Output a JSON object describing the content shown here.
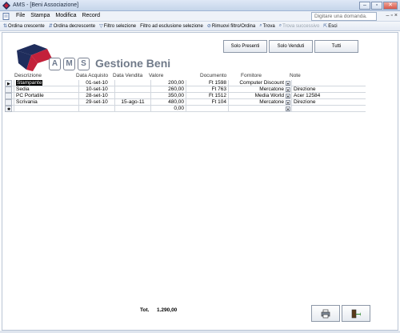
{
  "window": {
    "title": "AMS - [Beni Associazione]",
    "buttons": [
      "–",
      "▫",
      "✕"
    ]
  },
  "menu": {
    "items": [
      "File",
      "Stampa",
      "Modifica",
      "Record"
    ],
    "help_placeholder": "Digitare una domanda.",
    "mdi_buttons": [
      "–",
      "▫",
      "×"
    ]
  },
  "toolbar": {
    "sort_asc": "Ordina crescente",
    "sort_desc": "Ordina decrescente",
    "filter_sel": "Filtro selezione",
    "filter_excl": "Filtro ad esclusione selezione",
    "remove_filter": "Rimuovi filtro/Ordina",
    "find": "Trova",
    "find_next": "Trova successivo",
    "exit": "Esci"
  },
  "logo": {
    "letters": [
      "A",
      "M",
      "S"
    ],
    "title": "Gestione Beni",
    "colors": {
      "navy": "#1f2d5c",
      "red": "#c3213a",
      "gray": "#707a89"
    }
  },
  "filters": {
    "present": "Solo Presenti",
    "sold": "Solo Venduti",
    "all": "Tutti"
  },
  "columns": {
    "desc": "Descrizione",
    "acq": "Data Acquisto",
    "vend": "Data Vendita",
    "val": "Valore",
    "doc": "Documento",
    "forn": "Fornitore",
    "note": "Note"
  },
  "rows": [
    {
      "selector": "▶",
      "desc": "Stampante",
      "acq": "01-set-10",
      "vend": "",
      "val": "200,00",
      "doc": "Ft 1598",
      "forn": "Computer Discount",
      "note": ""
    },
    {
      "selector": "",
      "desc": "Sedia",
      "acq": "10-set-10",
      "vend": "",
      "val": "260,00",
      "doc": "Ft 763",
      "forn": "Mercatone",
      "note": "Direzione"
    },
    {
      "selector": "",
      "desc": "PC Portatile",
      "acq": "28-set-10",
      "vend": "",
      "val": "350,00",
      "doc": "Ft 1512",
      "forn": "Media World",
      "note": "Acer 12584"
    },
    {
      "selector": "",
      "desc": "Scrivania",
      "acq": "29-set-10",
      "vend": "15-ago-11",
      "val": "480,00",
      "doc": "Ft 104",
      "forn": "Mercatone",
      "note": "Direzione"
    }
  ],
  "new_row": {
    "selector": "✱",
    "val": "0,00"
  },
  "totals": {
    "label": "Tot.",
    "value": "1.290,00"
  }
}
